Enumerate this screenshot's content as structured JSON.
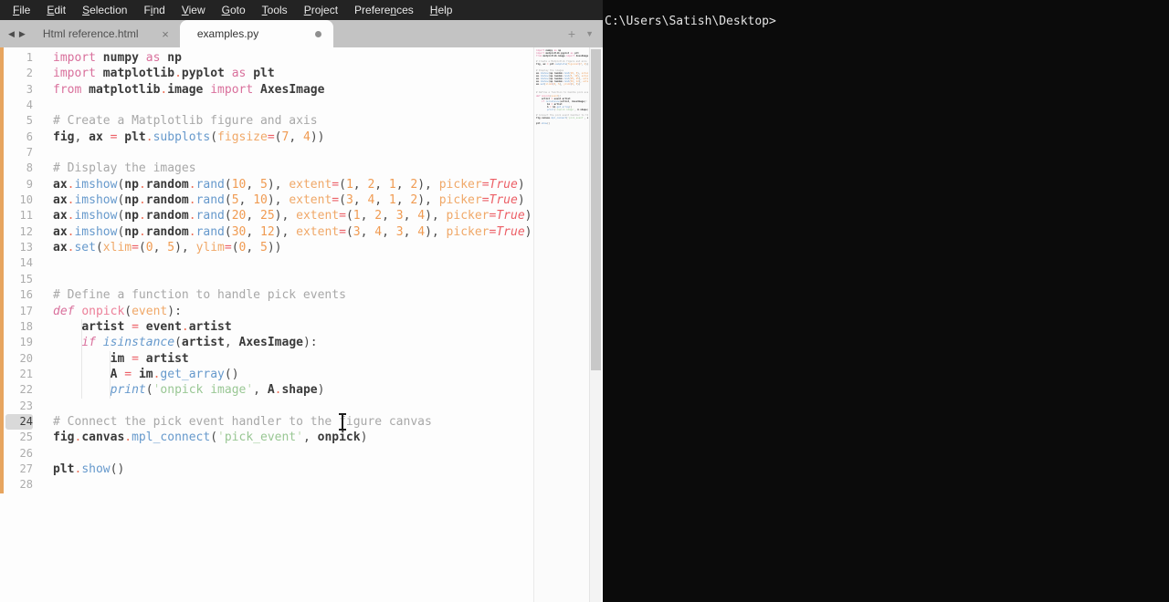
{
  "menubar": {
    "items": [
      {
        "label": "File",
        "u": 0
      },
      {
        "label": "Edit",
        "u": 0
      },
      {
        "label": "Selection",
        "u": 0
      },
      {
        "label": "Find",
        "u": 1
      },
      {
        "label": "View",
        "u": 0
      },
      {
        "label": "Goto",
        "u": 0
      },
      {
        "label": "Tools",
        "u": 0
      },
      {
        "label": "Project",
        "u": 0
      },
      {
        "label": "Preferences",
        "u": 7
      },
      {
        "label": "Help",
        "u": 0
      }
    ]
  },
  "tabbar": {
    "back_icon": "◀",
    "forward_icon": "▶",
    "close_icon": "×",
    "new_tab_icon": "+",
    "tab_list_icon": "▼",
    "tabs": [
      {
        "label": "Html reference.html",
        "state": "inactive"
      },
      {
        "label": "examples.py",
        "state": "active",
        "modified": true
      }
    ]
  },
  "editor": {
    "language": "python",
    "active_line": 24,
    "lines": [
      [
        [
          "kw",
          "import "
        ],
        [
          "id",
          "numpy "
        ],
        [
          "kw",
          "as "
        ],
        [
          "id",
          "np"
        ]
      ],
      [
        [
          "kw",
          "import "
        ],
        [
          "id",
          "matplotlib"
        ],
        [
          "dot",
          "."
        ],
        [
          "id",
          "pyplot "
        ],
        [
          "kw",
          "as "
        ],
        [
          "id",
          "plt"
        ]
      ],
      [
        [
          "kw",
          "from "
        ],
        [
          "id",
          "matplotlib"
        ],
        [
          "dot",
          "."
        ],
        [
          "id",
          "image "
        ],
        [
          "kw",
          "import "
        ],
        [
          "id",
          "AxesImage"
        ]
      ],
      [],
      [
        [
          "com",
          "# Create a Matplotlib figure and axis"
        ]
      ],
      [
        [
          "id",
          "fig"
        ],
        [
          "pun",
          ", "
        ],
        [
          "id",
          "ax "
        ],
        [
          "op",
          "= "
        ],
        [
          "id",
          "plt"
        ],
        [
          "dot",
          "."
        ],
        [
          "fn",
          "subplots"
        ],
        [
          "pun",
          "("
        ],
        [
          "param",
          "figsize"
        ],
        [
          "op",
          "="
        ],
        [
          "pun",
          "("
        ],
        [
          "num",
          "7"
        ],
        [
          "pun",
          ", "
        ],
        [
          "num",
          "4"
        ],
        [
          "pun",
          "))"
        ]
      ],
      [],
      [
        [
          "com",
          "# Display the images"
        ]
      ],
      [
        [
          "id",
          "ax"
        ],
        [
          "dot",
          "."
        ],
        [
          "fn",
          "imshow"
        ],
        [
          "pun",
          "("
        ],
        [
          "id",
          "np"
        ],
        [
          "dot",
          "."
        ],
        [
          "id",
          "random"
        ],
        [
          "dot",
          "."
        ],
        [
          "fn",
          "rand"
        ],
        [
          "pun",
          "("
        ],
        [
          "num",
          "10"
        ],
        [
          "pun",
          ", "
        ],
        [
          "num",
          "5"
        ],
        [
          "pun",
          "), "
        ],
        [
          "param",
          "extent"
        ],
        [
          "op",
          "="
        ],
        [
          "pun",
          "("
        ],
        [
          "num",
          "1"
        ],
        [
          "pun",
          ", "
        ],
        [
          "num",
          "2"
        ],
        [
          "pun",
          ", "
        ],
        [
          "num",
          "1"
        ],
        [
          "pun",
          ", "
        ],
        [
          "num",
          "2"
        ],
        [
          "pun",
          "), "
        ],
        [
          "param",
          "picker"
        ],
        [
          "op",
          "="
        ],
        [
          "true",
          "True"
        ],
        [
          "pun",
          ")"
        ]
      ],
      [
        [
          "id",
          "ax"
        ],
        [
          "dot",
          "."
        ],
        [
          "fn",
          "imshow"
        ],
        [
          "pun",
          "("
        ],
        [
          "id",
          "np"
        ],
        [
          "dot",
          "."
        ],
        [
          "id",
          "random"
        ],
        [
          "dot",
          "."
        ],
        [
          "fn",
          "rand"
        ],
        [
          "pun",
          "("
        ],
        [
          "num",
          "5"
        ],
        [
          "pun",
          ", "
        ],
        [
          "num",
          "10"
        ],
        [
          "pun",
          "), "
        ],
        [
          "param",
          "extent"
        ],
        [
          "op",
          "="
        ],
        [
          "pun",
          "("
        ],
        [
          "num",
          "3"
        ],
        [
          "pun",
          ", "
        ],
        [
          "num",
          "4"
        ],
        [
          "pun",
          ", "
        ],
        [
          "num",
          "1"
        ],
        [
          "pun",
          ", "
        ],
        [
          "num",
          "2"
        ],
        [
          "pun",
          "), "
        ],
        [
          "param",
          "picker"
        ],
        [
          "op",
          "="
        ],
        [
          "true",
          "True"
        ],
        [
          "pun",
          ")"
        ]
      ],
      [
        [
          "id",
          "ax"
        ],
        [
          "dot",
          "."
        ],
        [
          "fn",
          "imshow"
        ],
        [
          "pun",
          "("
        ],
        [
          "id",
          "np"
        ],
        [
          "dot",
          "."
        ],
        [
          "id",
          "random"
        ],
        [
          "dot",
          "."
        ],
        [
          "fn",
          "rand"
        ],
        [
          "pun",
          "("
        ],
        [
          "num",
          "20"
        ],
        [
          "pun",
          ", "
        ],
        [
          "num",
          "25"
        ],
        [
          "pun",
          "), "
        ],
        [
          "param",
          "extent"
        ],
        [
          "op",
          "="
        ],
        [
          "pun",
          "("
        ],
        [
          "num",
          "1"
        ],
        [
          "pun",
          ", "
        ],
        [
          "num",
          "2"
        ],
        [
          "pun",
          ", "
        ],
        [
          "num",
          "3"
        ],
        [
          "pun",
          ", "
        ],
        [
          "num",
          "4"
        ],
        [
          "pun",
          "), "
        ],
        [
          "param",
          "picker"
        ],
        [
          "op",
          "="
        ],
        [
          "true",
          "True"
        ],
        [
          "pun",
          ")"
        ]
      ],
      [
        [
          "id",
          "ax"
        ],
        [
          "dot",
          "."
        ],
        [
          "fn",
          "imshow"
        ],
        [
          "pun",
          "("
        ],
        [
          "id",
          "np"
        ],
        [
          "dot",
          "."
        ],
        [
          "id",
          "random"
        ],
        [
          "dot",
          "."
        ],
        [
          "fn",
          "rand"
        ],
        [
          "pun",
          "("
        ],
        [
          "num",
          "30"
        ],
        [
          "pun",
          ", "
        ],
        [
          "num",
          "12"
        ],
        [
          "pun",
          "), "
        ],
        [
          "param",
          "extent"
        ],
        [
          "op",
          "="
        ],
        [
          "pun",
          "("
        ],
        [
          "num",
          "3"
        ],
        [
          "pun",
          ", "
        ],
        [
          "num",
          "4"
        ],
        [
          "pun",
          ", "
        ],
        [
          "num",
          "3"
        ],
        [
          "pun",
          ", "
        ],
        [
          "num",
          "4"
        ],
        [
          "pun",
          "), "
        ],
        [
          "param",
          "picker"
        ],
        [
          "op",
          "="
        ],
        [
          "true",
          "True"
        ],
        [
          "pun",
          ")"
        ]
      ],
      [
        [
          "id",
          "ax"
        ],
        [
          "dot",
          "."
        ],
        [
          "fn",
          "set"
        ],
        [
          "pun",
          "("
        ],
        [
          "param",
          "xlim"
        ],
        [
          "op",
          "="
        ],
        [
          "pun",
          "("
        ],
        [
          "num",
          "0"
        ],
        [
          "pun",
          ", "
        ],
        [
          "num",
          "5"
        ],
        [
          "pun",
          "), "
        ],
        [
          "param",
          "ylim"
        ],
        [
          "op",
          "="
        ],
        [
          "pun",
          "("
        ],
        [
          "num",
          "0"
        ],
        [
          "pun",
          ", "
        ],
        [
          "num",
          "5"
        ],
        [
          "pun",
          "))"
        ]
      ],
      [],
      [],
      [
        [
          "com",
          "# Define a function to handle pick events"
        ]
      ],
      [
        [
          "kwi",
          "def "
        ],
        [
          "fname",
          "onpick"
        ],
        [
          "pun",
          "("
        ],
        [
          "param",
          "event"
        ],
        [
          "pun",
          "):"
        ]
      ],
      [
        [
          "pun",
          "    "
        ],
        [
          "id",
          "artist "
        ],
        [
          "op",
          "= "
        ],
        [
          "id",
          "event"
        ],
        [
          "dot",
          "."
        ],
        [
          "id",
          "artist"
        ]
      ],
      [
        [
          "pun",
          "    "
        ],
        [
          "kwi",
          "if "
        ],
        [
          "fni",
          "isinstance"
        ],
        [
          "pun",
          "("
        ],
        [
          "id",
          "artist"
        ],
        [
          "pun",
          ", "
        ],
        [
          "id",
          "AxesImage"
        ],
        [
          "pun",
          "):"
        ]
      ],
      [
        [
          "pun",
          "        "
        ],
        [
          "id",
          "im "
        ],
        [
          "op",
          "= "
        ],
        [
          "id",
          "artist"
        ]
      ],
      [
        [
          "pun",
          "        "
        ],
        [
          "id",
          "A "
        ],
        [
          "op",
          "= "
        ],
        [
          "id",
          "im"
        ],
        [
          "dot",
          "."
        ],
        [
          "fn",
          "get_array"
        ],
        [
          "pun",
          "()"
        ]
      ],
      [
        [
          "pun",
          "        "
        ],
        [
          "fni",
          "print"
        ],
        [
          "pun",
          "("
        ],
        [
          "strq",
          "'"
        ],
        [
          "str",
          "onpick image"
        ],
        [
          "strq",
          "'"
        ],
        [
          "pun",
          ", "
        ],
        [
          "id",
          "A"
        ],
        [
          "dot",
          "."
        ],
        [
          "id",
          "shape"
        ],
        [
          "pun",
          ")"
        ]
      ],
      [],
      [
        [
          "com",
          "# Connect the pick event handler to the figure canvas"
        ]
      ],
      [
        [
          "id",
          "fig"
        ],
        [
          "dot",
          "."
        ],
        [
          "id",
          "canvas"
        ],
        [
          "dot",
          "."
        ],
        [
          "fn",
          "mpl_connect"
        ],
        [
          "pun",
          "("
        ],
        [
          "strq",
          "'"
        ],
        [
          "str",
          "pick_event"
        ],
        [
          "strq",
          "'"
        ],
        [
          "pun",
          ", "
        ],
        [
          "id",
          "onpick"
        ],
        [
          "pun",
          ")"
        ]
      ],
      [],
      [
        [
          "id",
          "plt"
        ],
        [
          "dot",
          "."
        ],
        [
          "fn",
          "show"
        ],
        [
          "pun",
          "()"
        ]
      ],
      []
    ]
  },
  "terminal": {
    "prompt": "C:\\Users\\Satish\\Desktop>"
  },
  "colors": {
    "menubar_bg": "#232323",
    "tabbar_bg": "#c3c3c3",
    "editor_bg": "#fdfdfd",
    "gutter_accent": "#e7a55f",
    "keyword": "#d9709c",
    "function_call": "#6699cc",
    "number": "#f09b52",
    "parameter": "#f0a868",
    "operator": "#ec5f66",
    "string": "#99c794",
    "comment": "#a8a8a8",
    "terminal_bg": "#0b0b0b",
    "terminal_text": "#e3e3e3"
  }
}
